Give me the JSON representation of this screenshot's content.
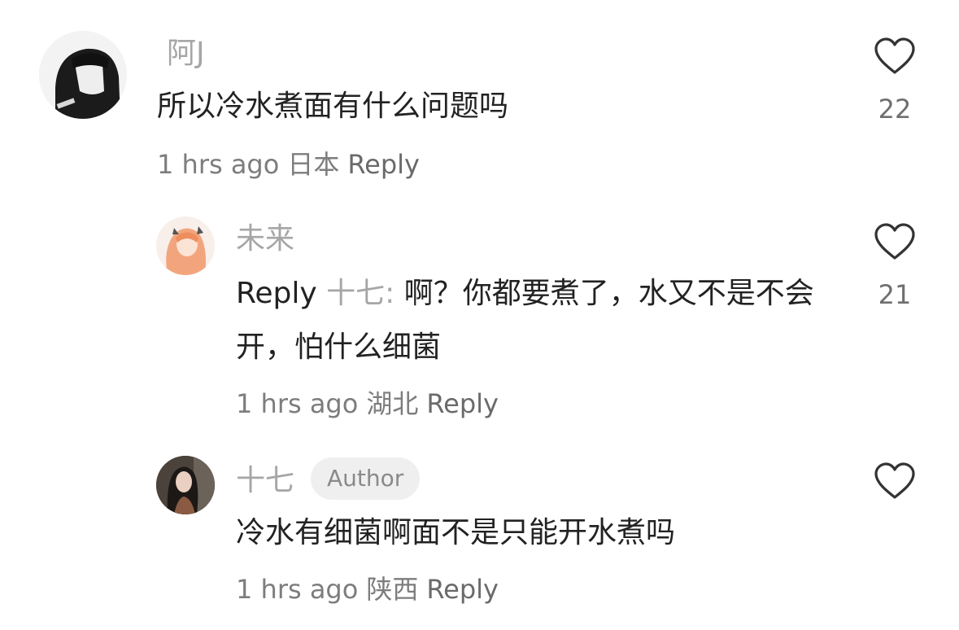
{
  "comments": [
    {
      "username": "阿J",
      "text": "所以冷水煮面有什么问题吗",
      "time": "1 hrs ago",
      "location": "日本",
      "reply_label": "Reply",
      "likes": "22"
    },
    {
      "username": "未来",
      "reply_prefix": "Reply",
      "reply_to": "十七:",
      "text": "啊？你都要煮了，水又不是不会开，怕什么细菌",
      "time": "1 hrs ago",
      "location": "湖北",
      "reply_label": "Reply",
      "likes": "21"
    },
    {
      "username": "十七",
      "badge": "Author",
      "text": "冷水有细菌啊面不是只能开水煮吗",
      "time": "1 hrs ago",
      "location": "陕西",
      "reply_label": "Reply",
      "likes": ""
    }
  ]
}
